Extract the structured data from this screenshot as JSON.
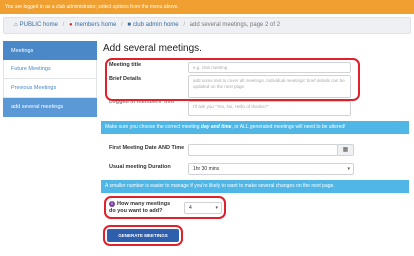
{
  "topbar": {
    "text": "You are logged in as a club administrator; select options from the menu above."
  },
  "breadcrumb": {
    "items": [
      {
        "icon": "home-icon",
        "label": "PUBLIC home"
      },
      {
        "icon": "user-icon",
        "label": "members home"
      },
      {
        "icon": "club-icon",
        "label": "club admin home"
      },
      {
        "label": "add several meetings, page 2 of 2"
      }
    ]
  },
  "sidebar": {
    "items": [
      {
        "label": "Meetings"
      },
      {
        "label": "Future Meetings"
      },
      {
        "label": "Previous Meetings"
      },
      {
        "label": "add several meetings"
      }
    ]
  },
  "main": {
    "title": "Add several meetings.",
    "meeting_title_label": "Meeting title",
    "meeting_title_placeholder": "e.g. club meeting",
    "brief_details_label": "Brief Details",
    "brief_details_placeholder": "add some text to cover all meetings. Individual meetings' brief details can be updated on the next page.",
    "logged_in_members_info_label": "Logged in members' info",
    "logged_in_members_info_placeholder": "I'll ask you \"Yes, No, Hello of thanks?\"",
    "warning_bar": {
      "before": "Make sure you choose the correct meeting ",
      "emphasis": "day and time",
      "after": ", or ALL generated meetings will need to be altered!"
    },
    "first_meeting_label": "First Meeting Date AND Time",
    "duration_label": "Usual meeting Duration",
    "duration_value": "1hr 30 mins",
    "info_bar": "A smaller number is easier to manage if you're likely to want to make several changes on the next page.",
    "how_many_label_line1": "How many meetings",
    "how_many_label_line2": "do you want to add?",
    "how_many_value": "4",
    "generate_button": "GENERATE MEETINGS"
  }
}
